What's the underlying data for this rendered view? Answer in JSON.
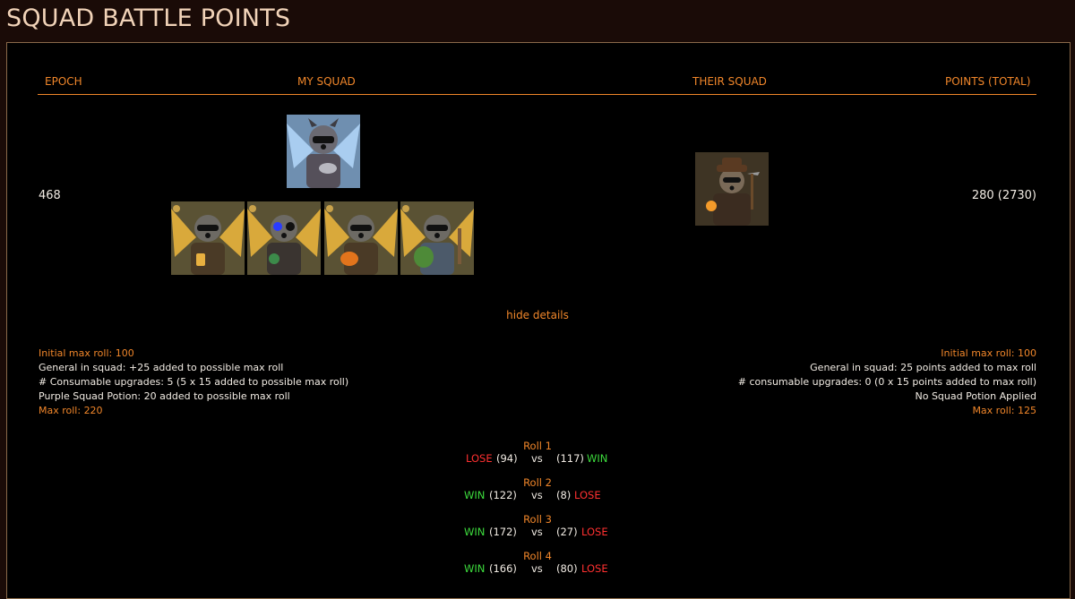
{
  "title": "SQUAD BATTLE POINTS",
  "headers": {
    "epoch": "EPOCH",
    "my_squad": "MY SQUAD",
    "their_squad": "THEIR SQUAD",
    "points": "POINTS (TOTAL)"
  },
  "row": {
    "epoch": "468",
    "points": "280 (2730)"
  },
  "my_squad": {
    "general": {
      "name": "general-avatar",
      "bg": "#7fa6c9",
      "accent": "#9cc6ef"
    },
    "members": [
      {
        "name": "member-1",
        "bg": "#7a6a2c",
        "item": "lantern"
      },
      {
        "name": "member-2",
        "bg": "#7a6a2c",
        "item": "potion"
      },
      {
        "name": "member-3",
        "bg": "#7a6a2c",
        "item": "pumpkin"
      },
      {
        "name": "member-4",
        "bg": "#7a6a2c",
        "item": "watermelon"
      }
    ]
  },
  "their_squad": {
    "general": {
      "name": "their-general-avatar",
      "bg": "#5a4a2c",
      "item": "pickaxe"
    }
  },
  "toggle": "hide details",
  "details_left": {
    "initial": "Initial max roll: 100",
    "general": "General in squad: +25 added to possible max roll",
    "consumables": "# Consumable upgrades: 5 (5 x 15 added to possible max roll)",
    "potion": "Purple Squad Potion: 20 added to possible max roll",
    "max": "Max roll: 220"
  },
  "details_right": {
    "initial": "Initial max roll: 100",
    "general": "General in squad: 25 points added to max roll",
    "consumables": "# consumable upgrades: 0 (0 x 15 points added to max roll)",
    "potion": "No Squad Potion Applied",
    "max": "Max roll: 125"
  },
  "rolls": [
    {
      "title": "Roll 1",
      "left_result": "LOSE",
      "left_value": "(94)",
      "vs": "vs",
      "right_value": "(117)",
      "right_result": "WIN"
    },
    {
      "title": "Roll 2",
      "left_result": "WIN",
      "left_value": "(122)",
      "vs": "vs",
      "right_value": "(8)",
      "right_result": "LOSE"
    },
    {
      "title": "Roll 3",
      "left_result": "WIN",
      "left_value": "(172)",
      "vs": "vs",
      "right_value": "(27)",
      "right_result": "LOSE"
    },
    {
      "title": "Roll 4",
      "left_result": "WIN",
      "left_value": "(166)",
      "vs": "vs",
      "right_value": "(80)",
      "right_result": "LOSE"
    }
  ],
  "colors": {
    "accent": "#f0862a",
    "win": "#3ddc3d",
    "lose": "#ff3030",
    "panel_bg": "#000000",
    "page_bg": "#1a0b07"
  }
}
